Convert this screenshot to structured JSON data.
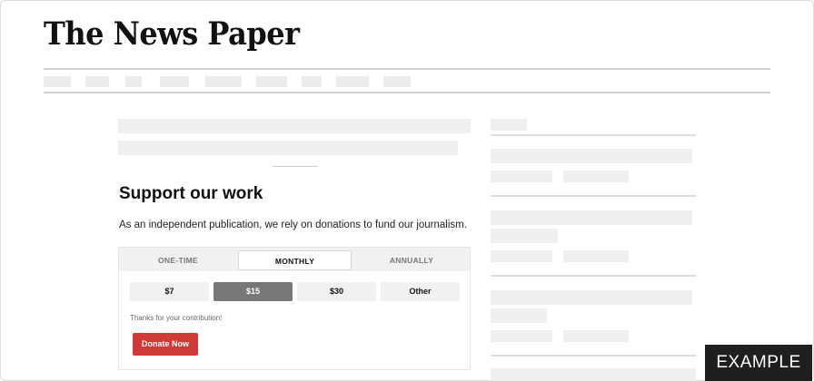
{
  "masthead": {
    "logo_text": "The News Paper"
  },
  "donation": {
    "title": "Support our work",
    "description": "As an independent publication, we rely on donations to fund our journalism.",
    "tabs": [
      {
        "label": "ONE-TIME",
        "active": false
      },
      {
        "label": "MONTHLY",
        "active": true
      },
      {
        "label": "ANNUALLY",
        "active": false
      }
    ],
    "amounts": [
      {
        "label": "$7",
        "selected": false
      },
      {
        "label": "$15",
        "selected": true
      },
      {
        "label": "$30",
        "selected": false
      },
      {
        "label": "Other",
        "selected": false
      }
    ],
    "thanks_text": "Thanks for your contribution!",
    "donate_label": "Donate Now"
  },
  "colors": {
    "donate_button": "#cf3a36",
    "selected_amount": "#777777",
    "placeholder": "#efefef"
  },
  "badge": {
    "label": "EXAMPLE"
  }
}
